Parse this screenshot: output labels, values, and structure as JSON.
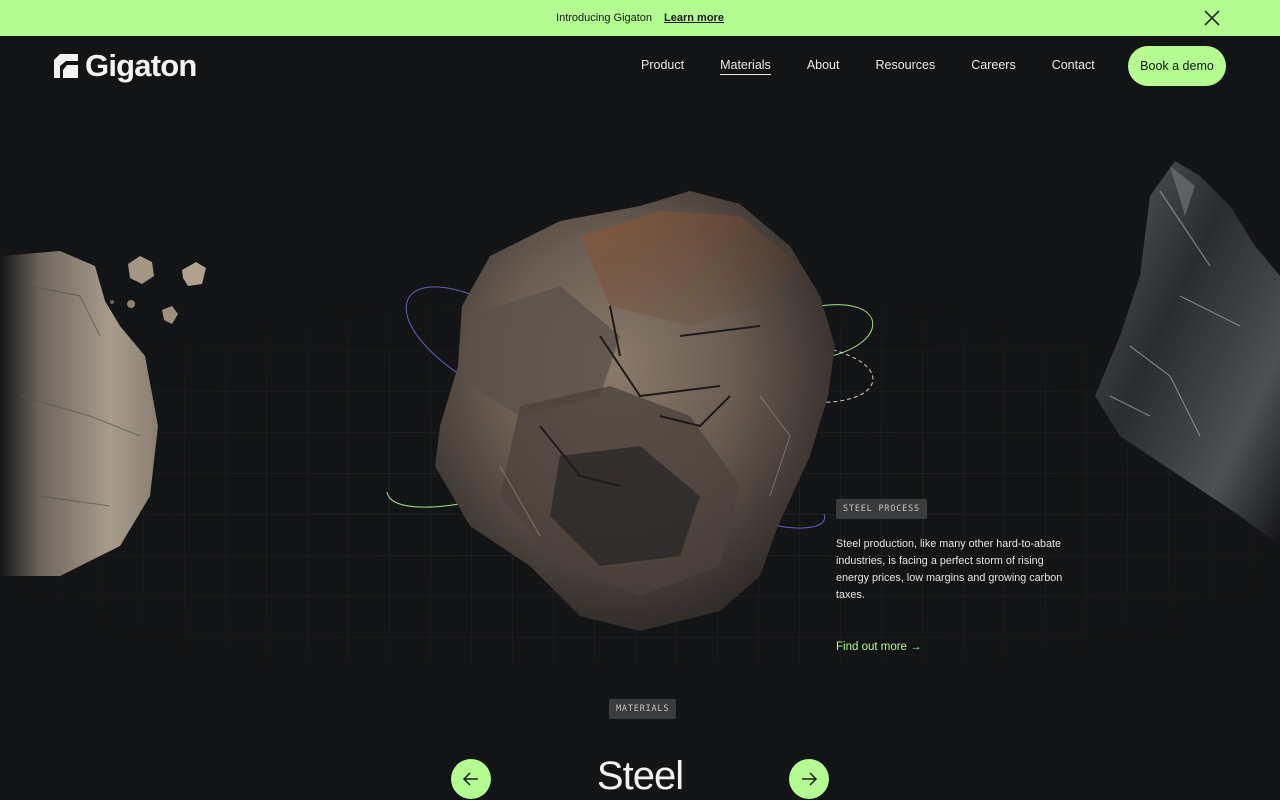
{
  "announcement": {
    "text": "Introducing Gigaton",
    "link": "Learn more"
  },
  "brand": {
    "name": "Gigaton",
    "accent": "#b4fb91",
    "background": "#131415"
  },
  "nav": {
    "items": [
      {
        "label": "Product"
      },
      {
        "label": "Materials",
        "active": true
      },
      {
        "label": "About"
      },
      {
        "label": "Resources"
      },
      {
        "label": "Careers"
      },
      {
        "label": "Contact"
      }
    ],
    "cta": "Book a demo"
  },
  "feature": {
    "tag": "STEEL PROCESS",
    "description": "Steel production, like many other hard-to-abate industries, is facing a perfect storm of rising energy prices, low margins and growing carbon taxes.",
    "link": "Find out more →"
  },
  "materials": {
    "tag": "MATERIALS",
    "current": "Steel",
    "icons": {
      "prev": "arrow-left-icon",
      "next": "arrow-right-icon",
      "close": "close-icon"
    }
  }
}
